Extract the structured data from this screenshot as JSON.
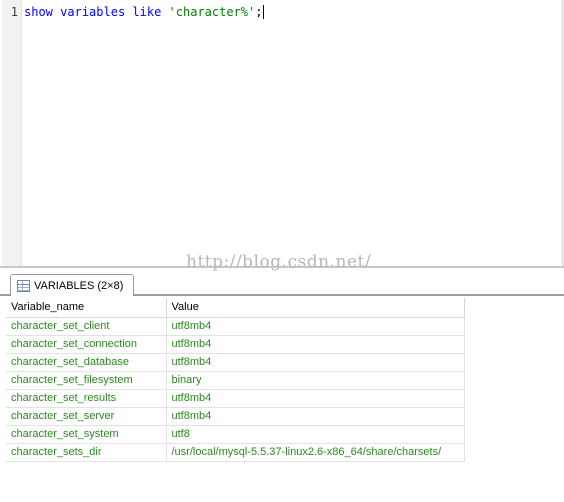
{
  "editor": {
    "line_number": "1",
    "code": {
      "kw1": "show",
      "kw2": "variables",
      "kw3": "like",
      "str": "'character%'",
      "end": ";"
    }
  },
  "watermark": "http://blog.csdn.net/",
  "results": {
    "tab_label": "VARIABLES (2×8)",
    "columns": [
      "Variable_name",
      "Value"
    ],
    "rows": [
      [
        "character_set_client",
        "utf8mb4"
      ],
      [
        "character_set_connection",
        "utf8mb4"
      ],
      [
        "character_set_database",
        "utf8mb4"
      ],
      [
        "character_set_filesystem",
        "binary"
      ],
      [
        "character_set_results",
        "utf8mb4"
      ],
      [
        "character_set_server",
        "utf8mb4"
      ],
      [
        "character_set_system",
        "utf8"
      ],
      [
        "character_sets_dir",
        "/usr/local/mysql-5.5.37-linux2.6-x86_64/share/charsets/"
      ]
    ]
  },
  "colors": {
    "keyword": "#0000ff",
    "string": "#008000",
    "cell_text": "#2b8a1e"
  }
}
